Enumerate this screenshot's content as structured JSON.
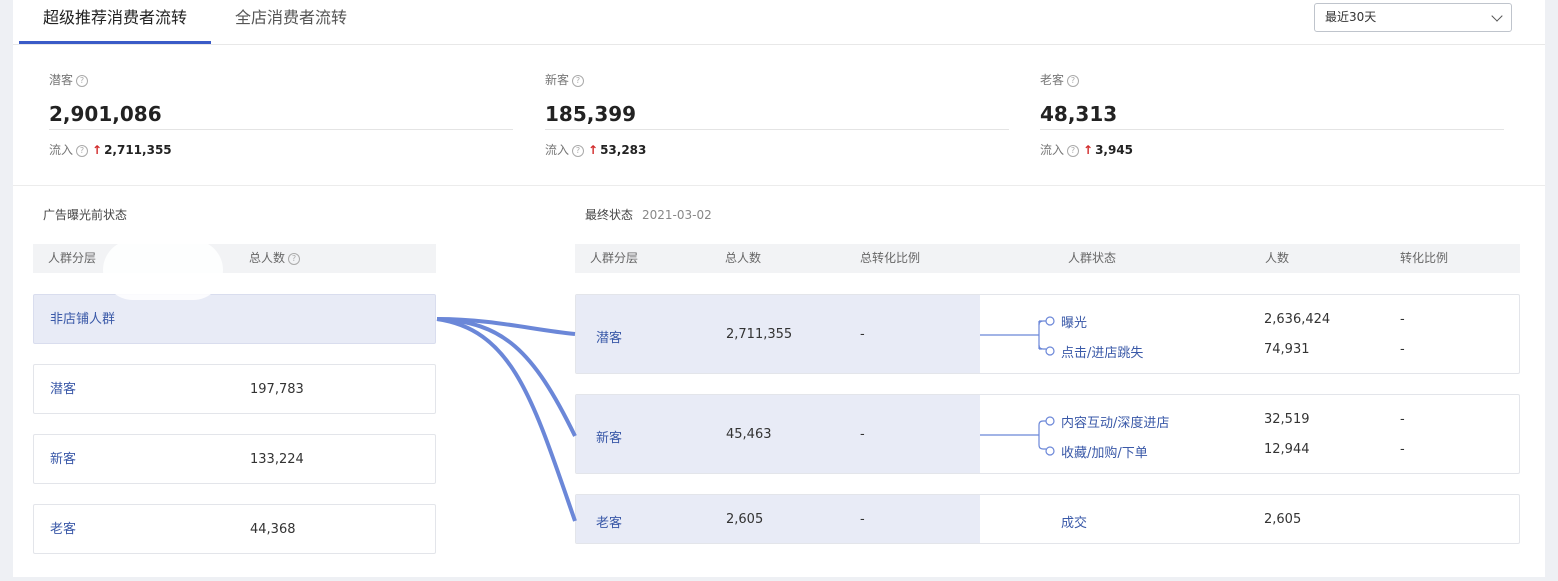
{
  "tabs": [
    {
      "label": "超级推荐消费者流转",
      "active": true
    },
    {
      "label": "全店消费者流转",
      "active": false
    }
  ],
  "date_select": {
    "value": "最近30天"
  },
  "stats": [
    {
      "label": "潜客",
      "value": "2,901,086",
      "inflow_label": "流入",
      "inflow_value": "2,711,355"
    },
    {
      "label": "新客",
      "value": "185,399",
      "inflow_label": "流入",
      "inflow_value": "53,283"
    },
    {
      "label": "老客",
      "value": "48,313",
      "inflow_label": "流入",
      "inflow_value": "3,945"
    }
  ],
  "left_section": {
    "title": "广告曝光前状态",
    "headers": [
      "人群分层",
      "总人数"
    ],
    "rows": [
      {
        "name": "非店铺人群",
        "value": ""
      },
      {
        "name": "潜客",
        "value": "197,783"
      },
      {
        "name": "新客",
        "value": "133,224"
      },
      {
        "name": "老客",
        "value": "44,368"
      }
    ]
  },
  "right_section": {
    "title": "最终状态",
    "date": "2021-03-02",
    "headers": [
      "人群分层",
      "总人数",
      "总转化比例",
      "人群状态",
      "人数",
      "转化比例"
    ],
    "rows": [
      {
        "name": "潜客",
        "total": "2,711,355",
        "ratio": "-",
        "states": [
          {
            "label": "曝光",
            "count": "2,636,424",
            "ratio": "-"
          },
          {
            "label": "点击/进店跳失",
            "count": "74,931",
            "ratio": "-"
          }
        ]
      },
      {
        "name": "新客",
        "total": "45,463",
        "ratio": "-",
        "states": [
          {
            "label": "内容互动/深度进店",
            "count": "32,519",
            "ratio": "-"
          },
          {
            "label": "收藏/加购/下单",
            "count": "12,944",
            "ratio": "-"
          }
        ]
      },
      {
        "name": "老客",
        "total": "2,605",
        "ratio": "-",
        "states": [
          {
            "label": "成交",
            "count": "2,605",
            "ratio": ""
          }
        ]
      }
    ]
  },
  "colors": {
    "accent": "#3a5bc7",
    "flow": "#6b87d8",
    "highlight_bg": "#e8ebf6",
    "up_arrow": "#d12a2a"
  }
}
